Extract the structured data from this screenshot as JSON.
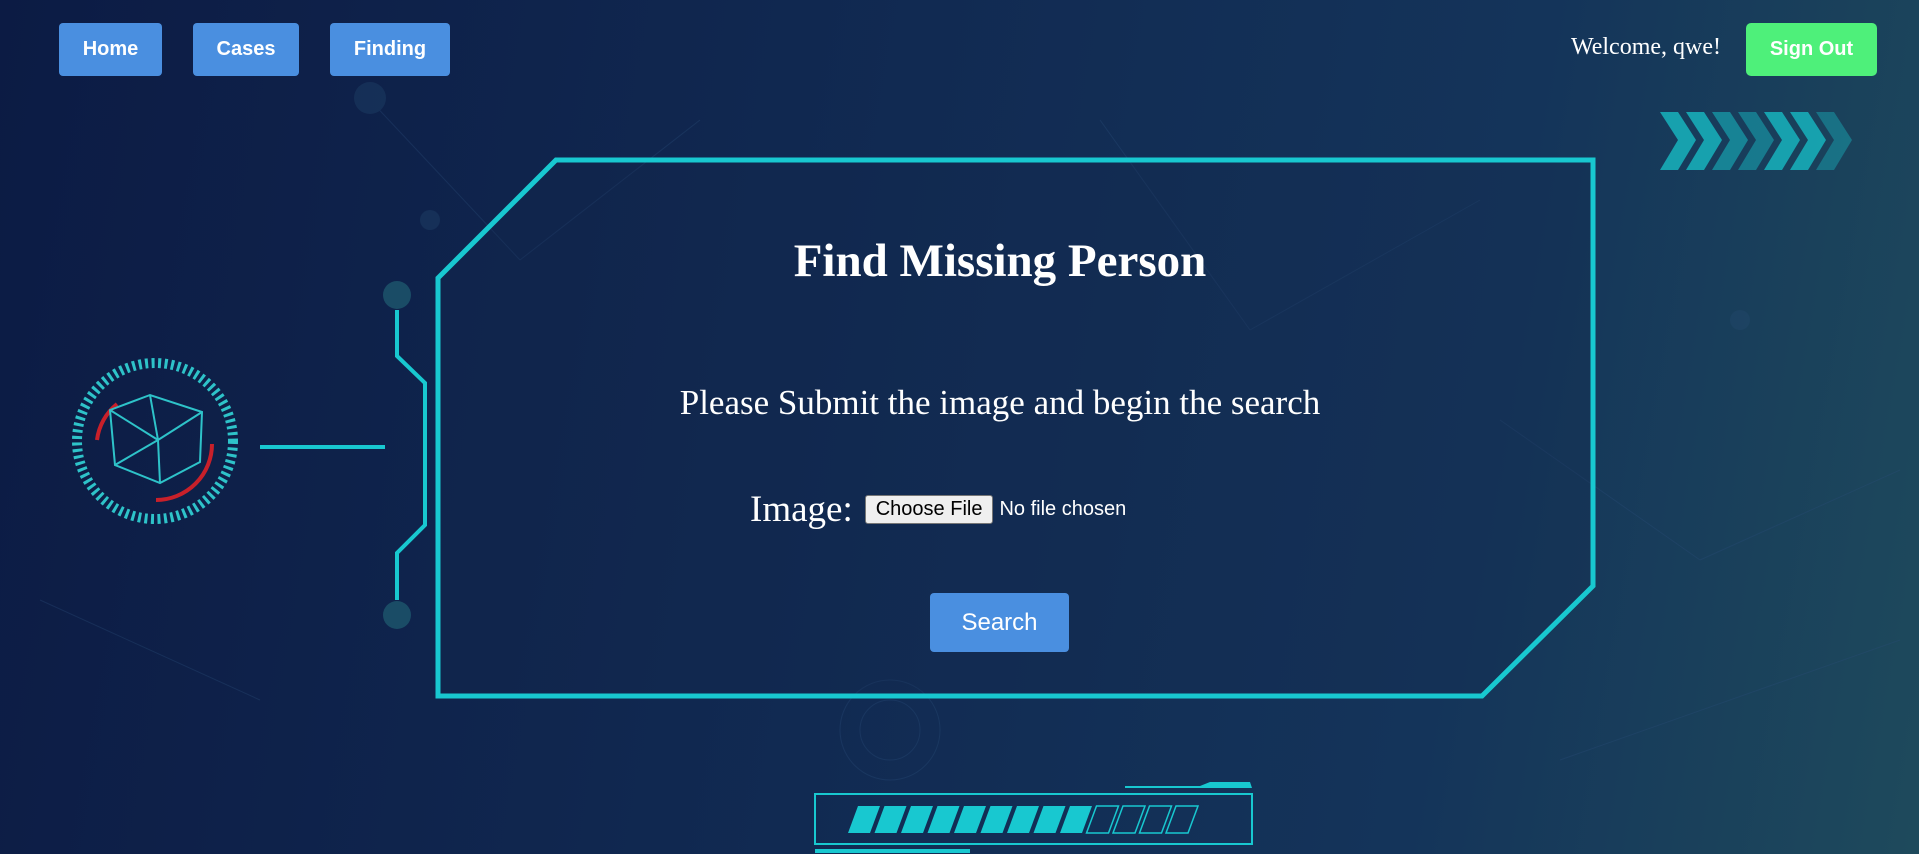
{
  "nav": {
    "home_label": "Home",
    "cases_label": "Cases",
    "finding_label": "Finding"
  },
  "user": {
    "welcome_text": "Welcome, qwe!",
    "signout_label": "Sign Out"
  },
  "main": {
    "title": "Find Missing Person",
    "subtitle": "Please Submit the image and begin the search",
    "image_label": "Image:",
    "file_button_label": "Choose File",
    "file_status": "No file chosen",
    "search_label": "Search"
  },
  "colors": {
    "accent_cyan": "#18c8d0",
    "button_blue": "#4a8fe0",
    "signout_green": "#4ef07a",
    "ring_red": "#c8202a"
  },
  "decor": {
    "progress_filled_fraction": 0.69,
    "progress_segments_total": 13
  }
}
